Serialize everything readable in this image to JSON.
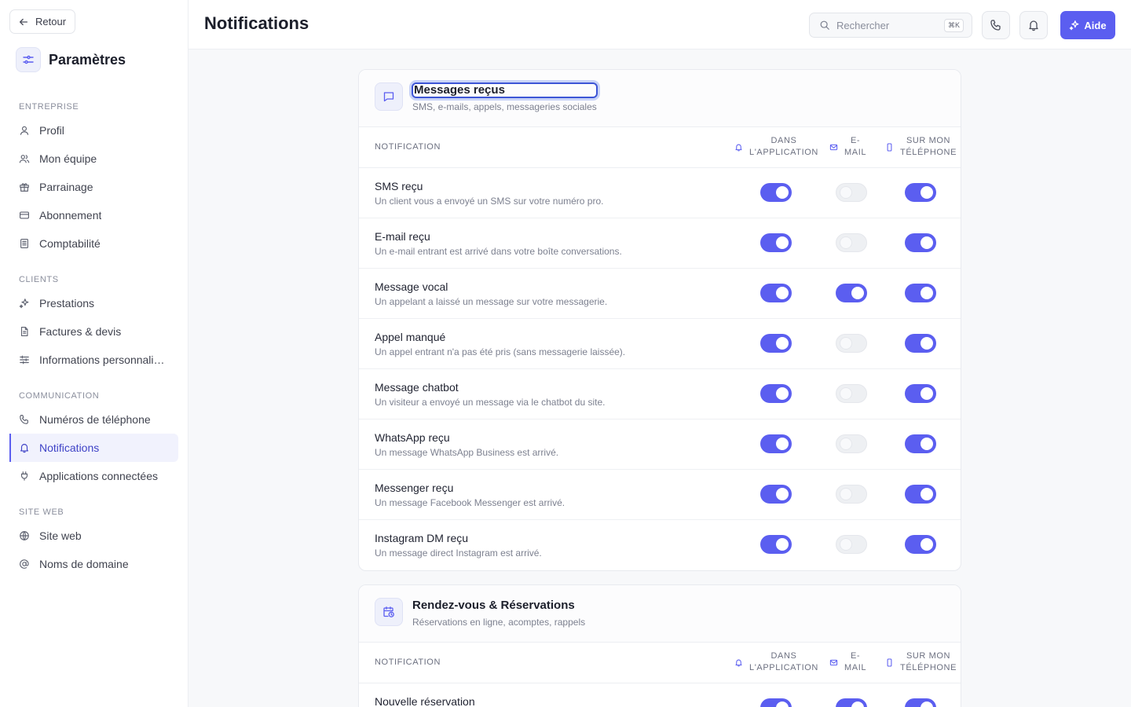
{
  "sidebar": {
    "back_label": "Retour",
    "brand_title": "Paramètres",
    "sections": [
      {
        "title": "ENTREPRISE",
        "items": [
          {
            "label": "Profil",
            "icon": "user-icon"
          },
          {
            "label": "Mon équipe",
            "icon": "users-icon"
          },
          {
            "label": "Parrainage",
            "icon": "gift-icon"
          },
          {
            "label": "Abonnement",
            "icon": "credit-card-icon"
          },
          {
            "label": "Comptabilité",
            "icon": "ledger-icon"
          }
        ]
      },
      {
        "title": "CLIENTS",
        "items": [
          {
            "label": "Prestations",
            "icon": "sparkles-icon"
          },
          {
            "label": "Factures & devis",
            "icon": "document-icon"
          },
          {
            "label": "Informations personnalisées",
            "icon": "sliders-icon"
          }
        ]
      },
      {
        "title": "COMMUNICATION",
        "items": [
          {
            "label": "Numéros de téléphone",
            "icon": "phone-icon"
          },
          {
            "label": "Notifications",
            "icon": "bell-icon",
            "active": true
          },
          {
            "label": "Applications connectées",
            "icon": "plug-icon"
          }
        ]
      },
      {
        "title": "SITE WEB",
        "items": [
          {
            "label": "Site web",
            "icon": "globe-icon"
          },
          {
            "label": "Noms de domaine",
            "icon": "at-sign-icon"
          }
        ]
      }
    ]
  },
  "header": {
    "title": "Notifications",
    "search_placeholder": "Rechercher",
    "search_shortcut": "⌘K",
    "help_label": "Aide"
  },
  "columns": {
    "notification": "NOTIFICATION",
    "app_line1": "DANS",
    "app_line2": "L'APPLICATION",
    "email_line1": "E-",
    "email_line2": "MAIL",
    "phone_line1": "SUR MON",
    "phone_line2": "TÉLÉPHONE"
  },
  "cards": [
    {
      "title": "Messages reçus",
      "subtitle": "SMS, e-mails, appels, messageries sociales",
      "icon": "message-square-icon",
      "rows": [
        {
          "title": "SMS reçu",
          "desc": "Un client vous a envoyé un SMS sur votre numéro pro.",
          "app": true,
          "email": false,
          "phone": true
        },
        {
          "title": "E-mail reçu",
          "desc": "Un e-mail entrant est arrivé dans votre boîte conversations.",
          "app": true,
          "email": false,
          "phone": true
        },
        {
          "title": "Message vocal",
          "desc": "Un appelant a laissé un message sur votre messagerie.",
          "app": true,
          "email": true,
          "phone": true
        },
        {
          "title": "Appel manqué",
          "desc": "Un appel entrant n'a pas été pris (sans messagerie laissée).",
          "app": true,
          "email": false,
          "phone": true
        },
        {
          "title": "Message chatbot",
          "desc": "Un visiteur a envoyé un message via le chatbot du site.",
          "app": true,
          "email": false,
          "phone": true
        },
        {
          "title": "WhatsApp reçu",
          "desc": "Un message WhatsApp Business est arrivé.",
          "app": true,
          "email": false,
          "phone": true
        },
        {
          "title": "Messenger reçu",
          "desc": "Un message Facebook Messenger est arrivé.",
          "app": true,
          "email": false,
          "phone": true
        },
        {
          "title": "Instagram DM reçu",
          "desc": "Un message direct Instagram est arrivé.",
          "app": true,
          "email": false,
          "phone": true
        }
      ]
    },
    {
      "title": "Rendez-vous & Réservations",
      "subtitle": "Réservations en ligne, acomptes, rappels",
      "icon": "calendar-clock-icon",
      "rows": [
        {
          "title": "Nouvelle réservation",
          "desc": "",
          "app": true,
          "email": true,
          "phone": true
        }
      ]
    }
  ],
  "colors": {
    "accent": "#5b5ef0",
    "toggle_off": "#eef0f3"
  }
}
